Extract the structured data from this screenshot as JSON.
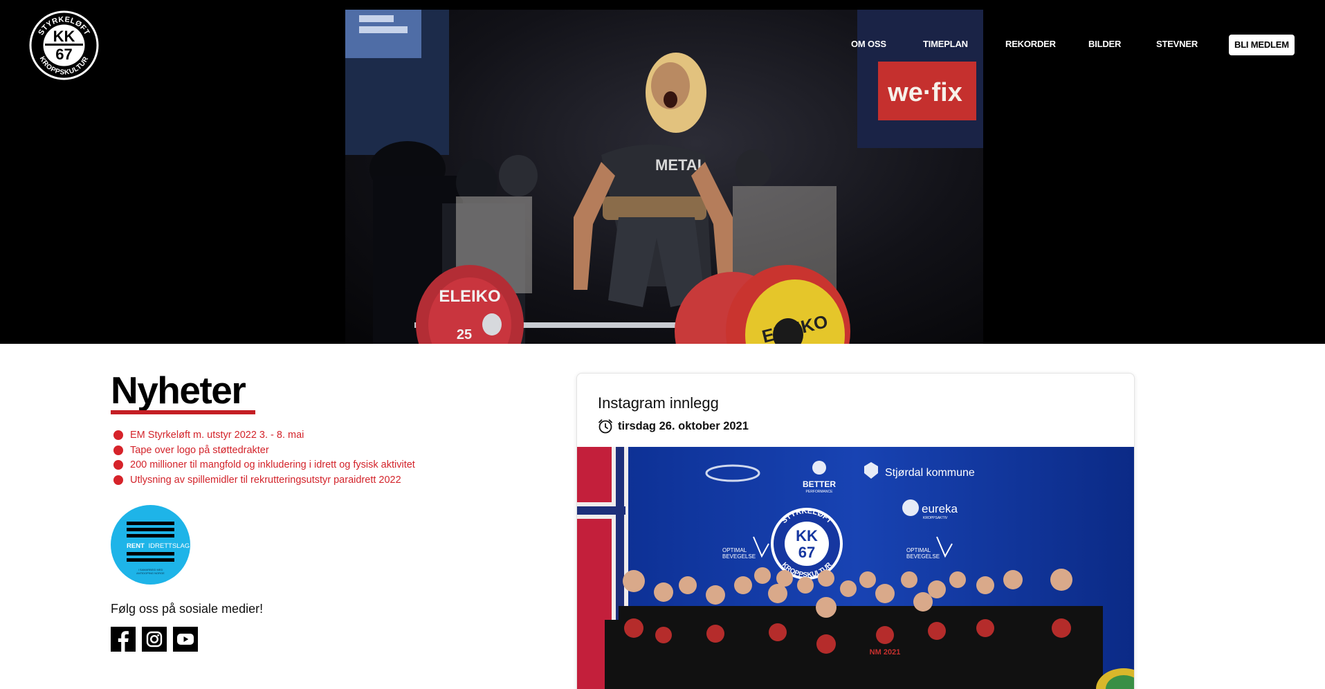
{
  "logo": {
    "top_text": "STYRKELØFT",
    "bottom_text": "KROPPSKULTUR",
    "line1": "KK",
    "line2": "67"
  },
  "nav": {
    "items": [
      {
        "label": "OM OSS"
      },
      {
        "label": "TIMEPLAN"
      },
      {
        "label": "REKORDER"
      },
      {
        "label": "BILDER"
      },
      {
        "label": "STEVNER"
      }
    ],
    "cta": "BLI MEDLEM"
  },
  "hero": {
    "banner_text": "we·fix",
    "plate_left": "ELEIKO",
    "plate_right": "ELEIKO",
    "plate_number": "25",
    "shirt_text": "METAL"
  },
  "news": {
    "title": "Nyheter",
    "items": [
      "EM Styrkeløft m. utstyr 2022 3. - 8. mai",
      "Tape over logo på støttedrakter",
      "200 millioner til mangfold og inkludering i idrett og fysisk aktivitet",
      "Utlysning av spillemidler til rekrutteringsutstyr paraidrett 2022"
    ]
  },
  "rent_badge": {
    "bold": "RENT",
    "rest": "IDRETTSLAG",
    "fine_print_1": "I SAMARBEID MED",
    "fine_print_2": "ANTIDOPING NORGE"
  },
  "social": {
    "label": "Følg oss på sosiale medier!",
    "icons": [
      "facebook-icon",
      "instagram-icon",
      "youtube-icon"
    ]
  },
  "instagram": {
    "title": "Instagram innlegg",
    "date": "tirsdag 26. oktober 2021",
    "backdrop": {
      "sponsor_1": "Stjørdal kommune",
      "sponsor_2": "BETTER",
      "sponsor_2_sub": "PERFORMANCE",
      "sponsor_3": "eureka",
      "sponsor_3_sub": "KROPPSAKTIV",
      "sponsor_4_a": "OPTIMAL",
      "sponsor_4_b": "BEVEGELSE",
      "logo_top": "STYRKELØFT",
      "logo_bottom": "KROPPSKULTUR",
      "logo_kk": "KK",
      "logo_67": "67",
      "shirt_text": "NM 2021"
    }
  },
  "colors": {
    "accent_red": "#d3242b",
    "underline_red": "#c41e24",
    "rent_blue": "#1eb4e8",
    "backdrop_blue": "#143ea7"
  }
}
